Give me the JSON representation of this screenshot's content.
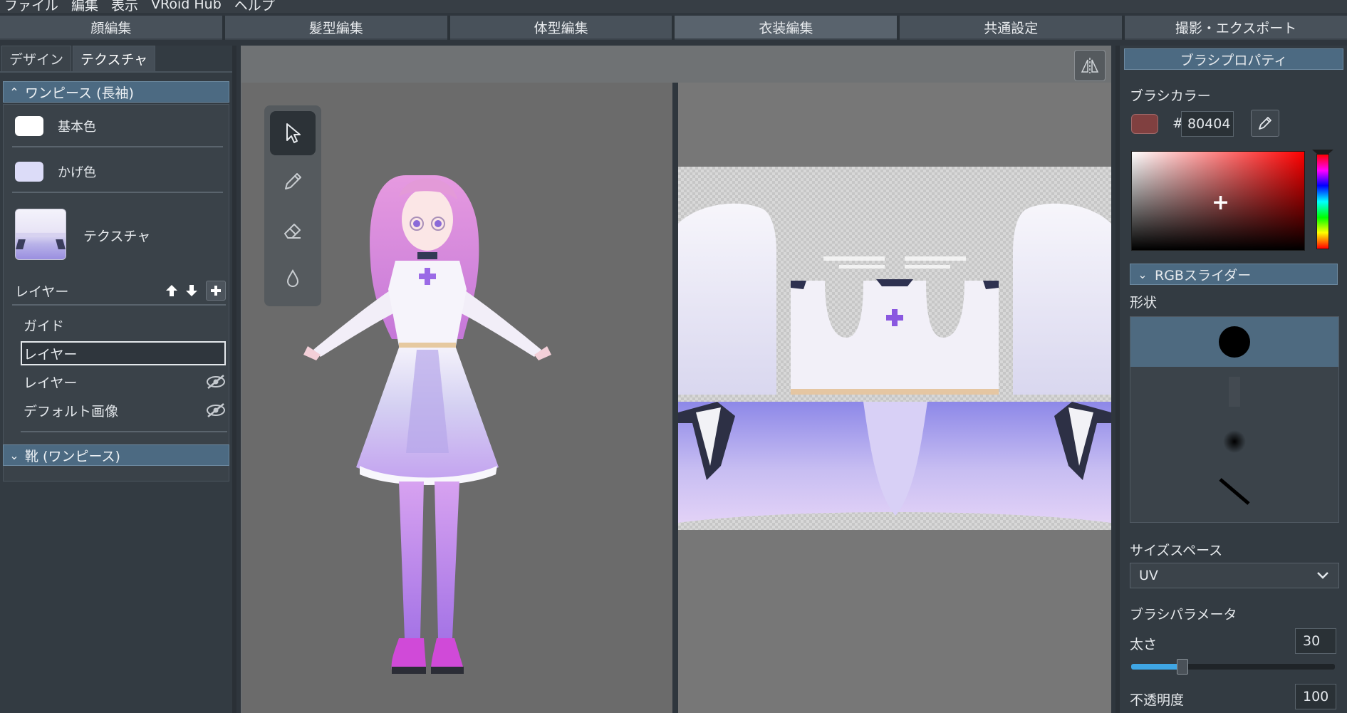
{
  "menu": [
    "ファイル",
    "編集",
    "表示",
    "VRoid Hub",
    "ヘルプ"
  ],
  "main_tabs": [
    {
      "label": "顔編集"
    },
    {
      "label": "髪型編集"
    },
    {
      "label": "体型編集"
    },
    {
      "label": "衣装編集",
      "active": true
    },
    {
      "label": "共通設定"
    },
    {
      "label": "撮影・エクスポート"
    }
  ],
  "left_panel": {
    "subtabs": [
      {
        "label": "デザイン"
      },
      {
        "label": "テクスチャ",
        "active": true
      }
    ],
    "section_onepiece": "ワンピース (長袖)",
    "base_color_label": "基本色",
    "base_color": "#ffffff",
    "shade_color_label": "かげ色",
    "shade_color": "#dcdcf8",
    "texture_label": "テクスチャ",
    "layer_header": "レイヤー",
    "layers": [
      {
        "label": "ガイド",
        "hidden": false
      },
      {
        "label": "レイヤー",
        "selected": true
      },
      {
        "label": "レイヤー",
        "hidden": true
      },
      {
        "label": "デフォルト画像",
        "hidden": true
      }
    ],
    "section_shoes": "靴 (ワンピース)"
  },
  "right_panel": {
    "title": "ブラシプロパティ",
    "brush_color_label": "ブラシカラー",
    "hex_prefix": "#",
    "hex_value": "80404",
    "brush_color": "#804040",
    "rgb_slider_label": "RGBスライダー",
    "shape_label": "形状",
    "size_space_label": "サイズスペース",
    "size_space_value": "UV",
    "brush_params_label": "ブラシパラメータ",
    "thickness_label": "太さ",
    "thickness_value": "30",
    "thickness_fraction": 0.25,
    "opacity_label": "不透明度",
    "opacity_value": "100"
  },
  "icons": {
    "tools": [
      "cursor-icon",
      "pen-icon",
      "eraser-icon",
      "fill-drop-icon"
    ],
    "mirror": "mirror-icon",
    "eyedropper": "eyedropper-icon"
  }
}
